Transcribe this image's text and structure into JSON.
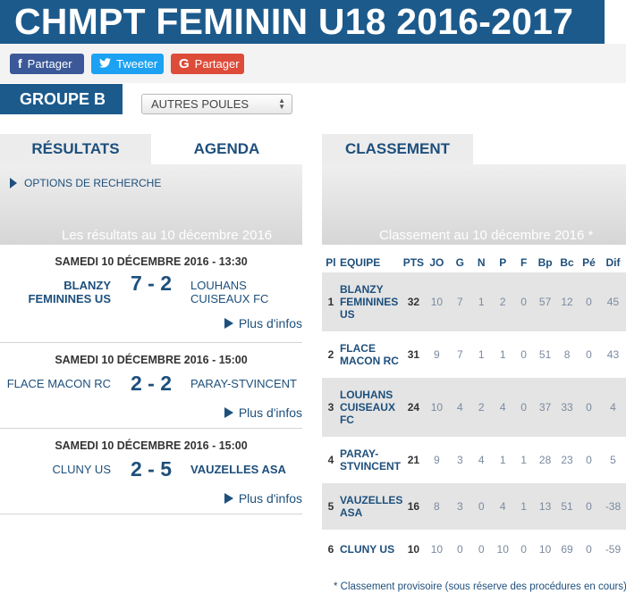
{
  "title": "CHMPT FEMININ U18 2016-2017",
  "share": {
    "facebook": {
      "icon": "f",
      "label": "Partager"
    },
    "twitter": {
      "icon": "🐦",
      "label": "Tweeter"
    },
    "google": {
      "icon": "G",
      "label": "Partager"
    }
  },
  "group": {
    "badge": "GROUPE B",
    "select_value": "AUTRES POULES"
  },
  "left": {
    "tabs": [
      "RÉSULTATS",
      "AGENDA"
    ],
    "options_label": "OPTIONS DE RECHERCHE",
    "caption": "Les résultats au 10 décembre 2016",
    "matches": [
      {
        "date": "SAMEDI 10 DÉCEMBRE 2016 - 13:30",
        "home": "BLANZY\nFEMININES US",
        "home_bold": true,
        "score": "7 - 2",
        "away": "LOUHANS\nCUISEAUX FC",
        "away_bold": false,
        "more": "Plus d'infos"
      },
      {
        "date": "SAMEDI 10 DÉCEMBRE 2016 - 15:00",
        "home": "FLACE MACON RC",
        "home_bold": false,
        "score": "2 - 2",
        "away": "PARAY-STVINCENT",
        "away_bold": false,
        "more": "Plus d'infos"
      },
      {
        "date": "SAMEDI 10 DÉCEMBRE 2016 - 15:00",
        "home": "CLUNY US",
        "home_bold": false,
        "score": "2 - 5",
        "away": "VAUZELLES ASA",
        "away_bold": true,
        "more": "Plus d'infos"
      }
    ]
  },
  "right": {
    "tab": "CLASSEMENT",
    "caption": "Classement au 10 décembre 2016 *",
    "headers": [
      "Pl",
      "EQUIPE",
      "PTS",
      "JO",
      "G",
      "N",
      "P",
      "F",
      "Bp",
      "Bc",
      "Pé",
      "Dif"
    ],
    "rows": [
      [
        "1",
        "BLANZY\nFEMININES\nUS",
        "32",
        "10",
        "7",
        "1",
        "2",
        "0",
        "57",
        "12",
        "0",
        "45"
      ],
      [
        "2",
        "FLACE\nMACON RC",
        "31",
        "9",
        "7",
        "1",
        "1",
        "0",
        "51",
        "8",
        "0",
        "43"
      ],
      [
        "3",
        "LOUHANS\nCUISEAUX\nFC",
        "24",
        "10",
        "4",
        "2",
        "4",
        "0",
        "37",
        "33",
        "0",
        "4"
      ],
      [
        "4",
        "PARAY-\nSTVINCENT",
        "21",
        "9",
        "3",
        "4",
        "1",
        "1",
        "28",
        "23",
        "0",
        "5"
      ],
      [
        "5",
        "VAUZELLES\nASA",
        "16",
        "8",
        "3",
        "0",
        "4",
        "1",
        "13",
        "51",
        "0",
        "-38"
      ],
      [
        "6",
        "CLUNY US",
        "10",
        "10",
        "0",
        "0",
        "10",
        "0",
        "10",
        "69",
        "0",
        "-59"
      ]
    ],
    "note": "* Classement provisoire (sous réserve des procédures en cours)"
  },
  "colors": {
    "brand": "#1c5a8c",
    "facebook": "#3b5998",
    "twitter": "#1da1f2",
    "google": "#dd4b39"
  }
}
